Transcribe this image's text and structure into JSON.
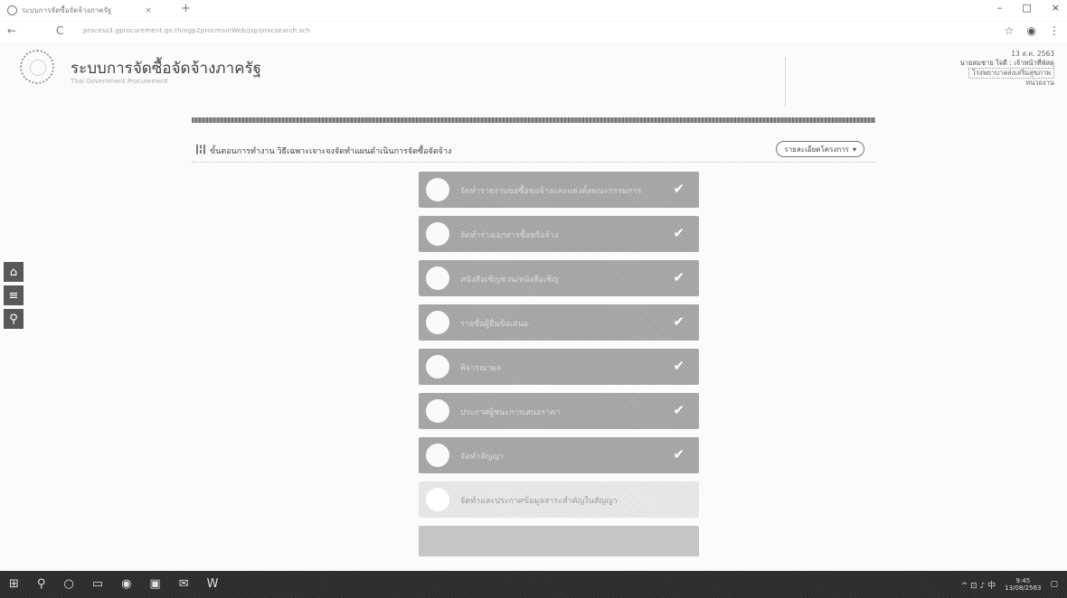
{
  "browser": {
    "tab_title": "ระบบการจัดซื้อจัดจ้างภาครัฐ",
    "tab_close": "×",
    "new_tab": "+",
    "back": "←",
    "reload": "C",
    "url": "process3.gprocurement.go.th/egp2procmainWeb/jsp/procsearch.sch",
    "star_icon": "☆",
    "profile_icon": "◉",
    "menu_icon": "⋮",
    "minimize": "–",
    "maximize": "□",
    "close": "×"
  },
  "header": {
    "title": "ระบบการจัดซื้อจัดจ้างภาครัฐ",
    "subtitle": "Thai Government Procurement",
    "user": {
      "date": "13 ส.ค. 2563",
      "name": "นายสมชาย ใจดี : เจ้าหน้าที่พัสดุ",
      "org": "โรงพยาบาลส่งเสริมสุขภาพ",
      "extra": "หน่วยงาน"
    }
  },
  "section": {
    "icon": "|¦|",
    "title": "ขั้นตอนการทำงาน วิธีเฉพาะเจาะจงจัดทำแผนดำเนินการจัดซื้อจัดจ้าง",
    "button": "รายละเอียดโครงการ",
    "button_caret": "▾"
  },
  "steps": [
    {
      "label": "จัดทำรายงานขอซื้อขอจ้างและแต่งตั้งคณะกรรมการ",
      "check": "✔"
    },
    {
      "label": "จัดทำร่างเอกสารซื้อหรือจ้าง",
      "check": "✔"
    },
    {
      "label": "หนังสือเชิญชวน/หนังสือเชิญ",
      "check": "✔"
    },
    {
      "label": "รายชื่อผู้ยื่นข้อเสนอ",
      "check": "✔"
    },
    {
      "label": "พิจารณาผล",
      "check": "✔"
    },
    {
      "label": "ประกาศผู้ชนะการเสนอราคา",
      "check": "✔"
    },
    {
      "label": "จัดทำสัญญา",
      "check": "✔"
    },
    {
      "label": "จัดทำและประกาศข้อมูลสาระสำคัญในสัญญา",
      "check": ""
    }
  ],
  "side_tools": [
    "⌂",
    "≡",
    "⚲"
  ],
  "taskbar": {
    "left": [
      "⊞",
      "⚲",
      "○",
      "▭",
      "◉",
      "▣",
      "✉",
      "W"
    ],
    "tray": "^ ⊡ ♪ 中",
    "time": "9:45",
    "date": "13/08/2563",
    "notify": "▢"
  }
}
